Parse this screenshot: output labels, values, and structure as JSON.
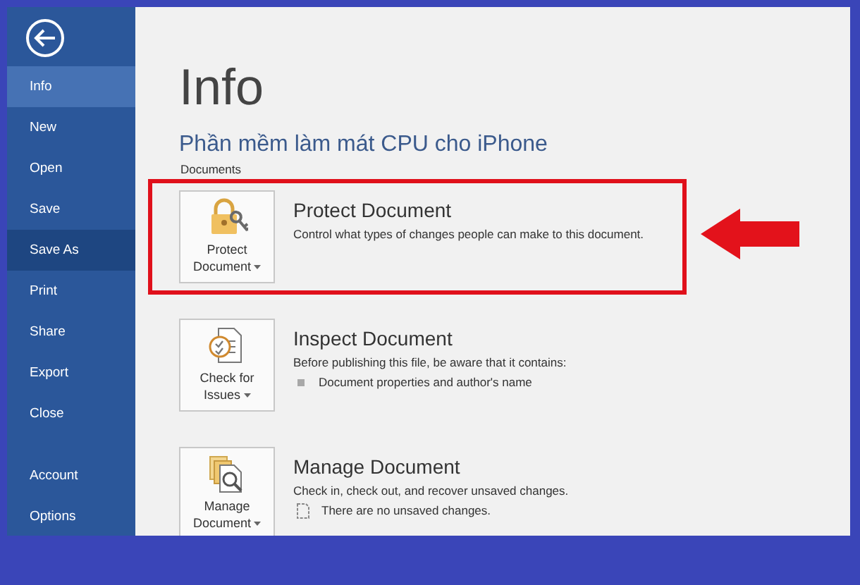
{
  "sidebar": {
    "items": [
      {
        "label": "Info",
        "selected": true,
        "hovered": false
      },
      {
        "label": "New",
        "selected": false,
        "hovered": false
      },
      {
        "label": "Open",
        "selected": false,
        "hovered": false
      },
      {
        "label": "Save",
        "selected": false,
        "hovered": false
      },
      {
        "label": "Save As",
        "selected": false,
        "hovered": true
      },
      {
        "label": "Print",
        "selected": false,
        "hovered": false
      },
      {
        "label": "Share",
        "selected": false,
        "hovered": false
      },
      {
        "label": "Export",
        "selected": false,
        "hovered": false
      },
      {
        "label": "Close",
        "selected": false,
        "hovered": false
      }
    ],
    "footer_items": [
      {
        "label": "Account",
        "selected": false,
        "hovered": false
      },
      {
        "label": "Options",
        "selected": false,
        "hovered": false
      }
    ]
  },
  "page": {
    "heading": "Info",
    "document_title": "Phần mềm làm mát CPU cho iPhone",
    "location": "Documents",
    "sections": [
      {
        "kind": "protect",
        "button_label": "Protect Document",
        "title": "Protect Document",
        "description": "Control what types of changes people can make to this document.",
        "highlighted": true
      },
      {
        "kind": "inspect",
        "button_label": "Check for Issues",
        "title": "Inspect Document",
        "description": "Before publishing this file, be aware that it contains:",
        "highlighted": false,
        "details": [
          {
            "kind": "bullet",
            "text": "Document properties and author's name"
          }
        ]
      },
      {
        "kind": "manage",
        "button_label": "Manage Document",
        "title": "Manage Document",
        "description": "Check in, check out, and recover unsaved changes.",
        "highlighted": false,
        "details": [
          {
            "kind": "document",
            "text": "There are no unsaved changes."
          }
        ]
      }
    ]
  }
}
